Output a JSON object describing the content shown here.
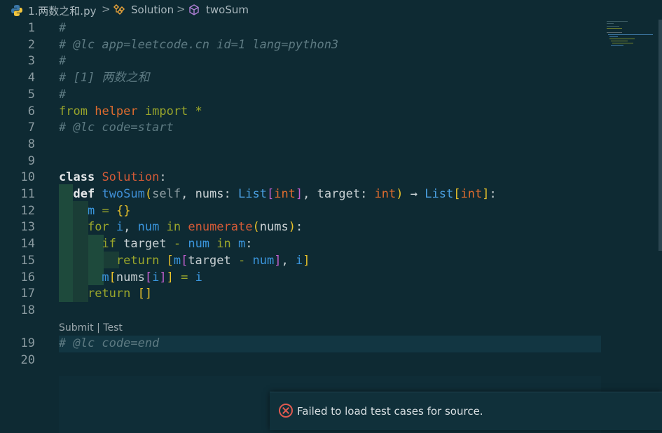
{
  "breadcrumb": {
    "file": "1.两数之和.py",
    "class": "Solution",
    "method": "twoSum",
    "separator": ">"
  },
  "editor": {
    "line_numbers": [
      "1",
      "2",
      "3",
      "4",
      "5",
      "6",
      "7",
      "8",
      "9",
      "10",
      "11",
      "12",
      "13",
      "14",
      "15",
      "16",
      "17",
      "18",
      "19",
      "20"
    ],
    "lines": {
      "l1": "#",
      "l2": "# @lc app=leetcode.cn id=1 lang=python3",
      "l3": "#",
      "l4": "# [1] 两数之和",
      "l5": "#",
      "l6_from": "from",
      "l6_mod": "helper",
      "l6_import": "import",
      "l6_star": "*",
      "l7": "# @lc code=start",
      "l10_class": "class",
      "l10_name": "Solution",
      "l10_colon": ":",
      "l11_def": "def",
      "l11_fn": "twoSum",
      "l11_self": "self",
      "l11_nums": "nums",
      "l11_list1": "List",
      "l11_int1": "int",
      "l11_target": "target",
      "l11_int2": "int",
      "l11_arrow": "→",
      "l11_list2": "List",
      "l11_int3": "int",
      "l12_m": "m",
      "l12_eq": "=",
      "l12_dict": "{}",
      "l13_for": "for",
      "l13_i": "i",
      "l13_num": "num",
      "l13_in": "in",
      "l13_enum": "enumerate",
      "l13_nums": "nums",
      "l14_if": "if",
      "l14_target": "target",
      "l14_minus": "-",
      "l14_num": "num",
      "l14_in": "in",
      "l14_m": "m",
      "l15_return": "return",
      "l15_m": "m",
      "l15_target": "target",
      "l15_minus": "-",
      "l15_num": "num",
      "l15_i": "i",
      "l16_m": "m",
      "l16_nums": "nums",
      "l16_i": "i",
      "l16_eq": "=",
      "l16_i2": "i",
      "l17_return": "return",
      "l17_list": "[]",
      "l19": "# @lc code=end"
    },
    "codelens": {
      "submit": "Submit",
      "sep": "|",
      "test": "Test"
    }
  },
  "notification": {
    "icon": "error-circle-icon",
    "message": "Failed to load test cases for source.",
    "color": "#e05a50"
  }
}
